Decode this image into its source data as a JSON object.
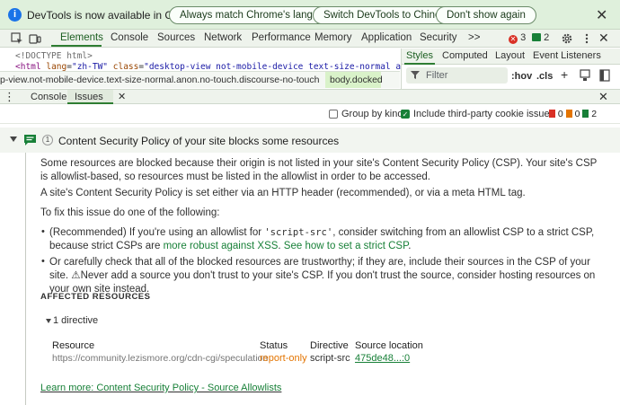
{
  "infobar": {
    "message": "DevTools is now available in Chinese!",
    "buttons": [
      "Always match Chrome's language",
      "Switch DevTools to Chinese",
      "Don't show again"
    ]
  },
  "main_tabs": [
    "Elements",
    "Console",
    "Sources",
    "Network",
    "Performance",
    "Memory",
    "Application",
    "Security"
  ],
  "more_tabs": ">>",
  "error_count": "3",
  "info_count": "2",
  "elements": {
    "doctype": "<!DOCTYPE html>",
    "html_tag": "<html",
    "lang_attr": "lang",
    "lang_val": "\"zh-TW\"",
    "class_attr": "class",
    "class_val": "\"desktop-view not-mobile-device text-size-normal anon no-touc",
    "crumb_text": "p-view.not-mobile-device.text-size-normal.anon.no-touch.discourse-no-touch",
    "crumb_active": "body.docked"
  },
  "styles": {
    "tabs": [
      "Styles",
      "Computed",
      "Layout",
      "Event Listeners"
    ],
    "filter_placeholder": "Filter",
    "hov": ":hov",
    "cls": ".cls"
  },
  "drawer": {
    "tabs": [
      "Console",
      "Issues"
    ]
  },
  "issues_toolbar": {
    "group_by_kind": "Group by kind",
    "include_third_party": "Include third-party cookie issues",
    "counts": [
      "0",
      "0",
      "2"
    ]
  },
  "issue": {
    "count": "1",
    "title": "Content Security Policy of your site blocks some resources",
    "p1": "Some resources are blocked because their origin is not listed in your site's Content Security Policy (CSP). Your site's CSP is allowlist-based, so resources must be listed in the allowlist in order to be accessed.",
    "p2": "A site's Content Security Policy is set either via an HTTP header (recommended), or via a meta HTML tag.",
    "p3": "To fix this issue do one of the following:",
    "b1_pre": "(Recommended) If you're using an allowlist for ",
    "b1_code": "'script-src'",
    "b1_mid": ", consider switching from an allowlist CSP to a strict CSP, because strict CSPs are ",
    "b1_link1": "more robust against XSS",
    "b1_sep": ". ",
    "b1_link2": "See how to set a strict CSP",
    "b1_end": ".",
    "b2": "Or carefully check that all of the blocked resources are trustworthy; if they are, include their sources in the CSP of your site. ⚠Never add a source you don't trust to your site's CSP. If you don't trust the source, consider hosting resources on your own site instead.",
    "affected": "AFFECTED RESOURCES",
    "directive_toggle": "1 directive",
    "columns": [
      "Resource",
      "Status",
      "Directive",
      "Source location"
    ],
    "row": {
      "resource": "https://community.lezismore.org/cdn-cgi/speculation",
      "status": "report-only",
      "directive": "script-src",
      "location": "475de48...:0"
    },
    "learn_more": "Learn more: Content Security Policy - Source Allowlists"
  },
  "colors": {
    "accent": "#188038",
    "error": "#d93025",
    "warning": "#e37400",
    "infobar_bg": "#dff0dc"
  }
}
